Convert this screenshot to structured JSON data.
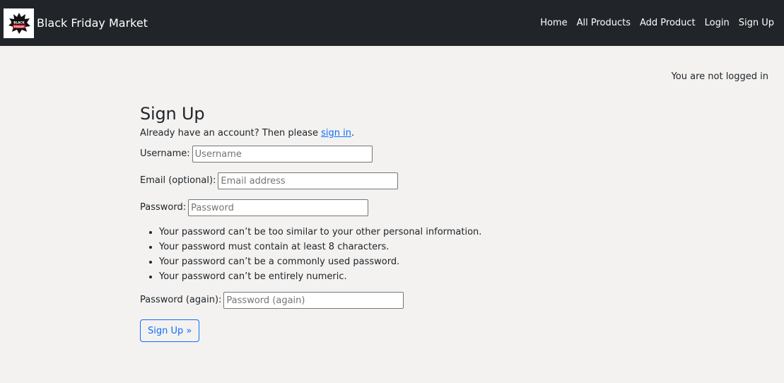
{
  "navbar": {
    "brand_title": "Black Friday Market",
    "logo_text": "BLACK FRIDAY",
    "links": [
      "Home",
      "All Products",
      "Add Product",
      "Login",
      "Sign Up"
    ]
  },
  "login_status": "You are not logged in",
  "form": {
    "title": "Sign Up",
    "account_prompt": "Already have an account? Then please ",
    "sign_in_link": "sign in",
    "account_suffix": ".",
    "username": {
      "label": "Username:",
      "placeholder": "Username"
    },
    "email": {
      "label": "Email (optional):",
      "placeholder": "Email address"
    },
    "password": {
      "label": "Password:",
      "placeholder": "Password"
    },
    "password_help": [
      "Your password can’t be too similar to your other personal information.",
      "Your password must contain at least 8 characters.",
      "Your password can’t be a commonly used password.",
      "Your password can’t be entirely numeric."
    ],
    "password2": {
      "label": "Password (again):",
      "placeholder": "Password (again)"
    },
    "submit_label": "Sign Up »"
  },
  "colors": {
    "navbar_bg": "#212529",
    "page_bg": "#f3f2f1",
    "accent": "#0d6efd",
    "logo_red": "#d21f2b"
  }
}
